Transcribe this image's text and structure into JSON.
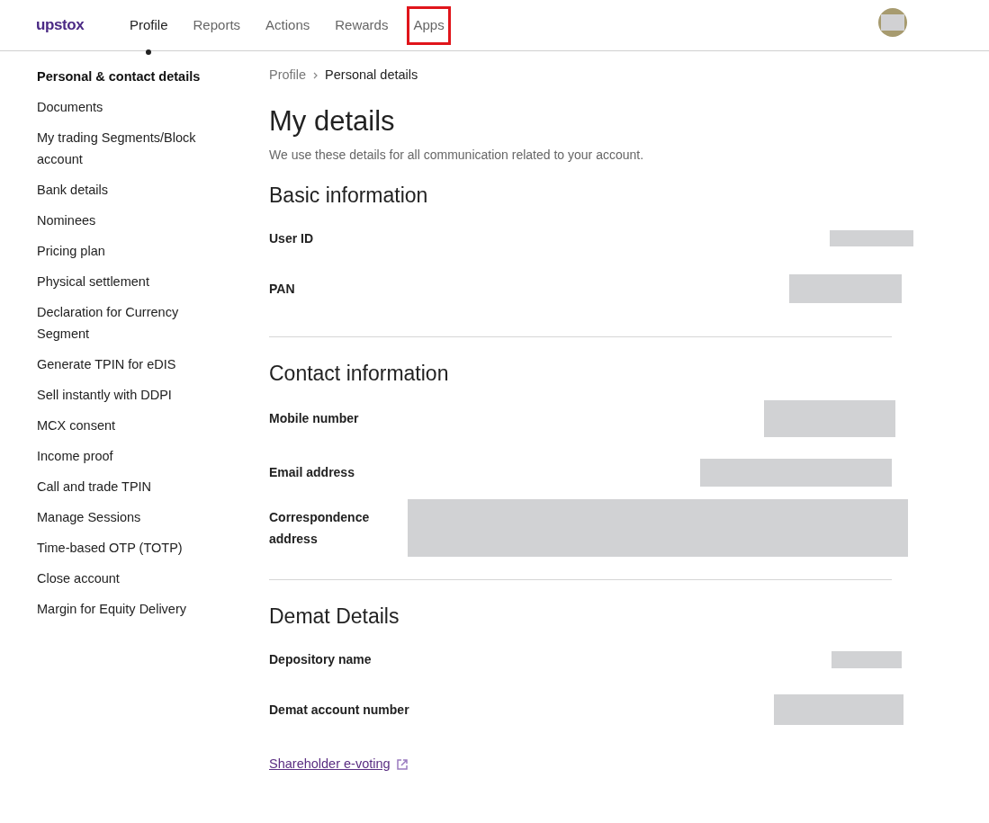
{
  "header": {
    "logo": "upstox",
    "tabs": [
      {
        "label": "Profile",
        "selected": true,
        "highlighted": false
      },
      {
        "label": "Reports",
        "selected": false,
        "highlighted": false
      },
      {
        "label": "Actions",
        "selected": false,
        "highlighted": false
      },
      {
        "label": "Rewards",
        "selected": false,
        "highlighted": false
      },
      {
        "label": "Apps",
        "selected": false,
        "highlighted": true
      }
    ]
  },
  "sidebar": {
    "items": [
      {
        "label": "Personal & contact details",
        "selected": true
      },
      {
        "label": "Documents",
        "selected": false
      },
      {
        "label": "My trading Segments/Block account",
        "selected": false
      },
      {
        "label": "Bank details",
        "selected": false
      },
      {
        "label": "Nominees",
        "selected": false
      },
      {
        "label": "Pricing plan",
        "selected": false
      },
      {
        "label": "Physical settlement",
        "selected": false
      },
      {
        "label": "Declaration for Currency Segment",
        "selected": false
      },
      {
        "label": "Generate TPIN for eDIS",
        "selected": false
      },
      {
        "label": "Sell instantly with DDPI",
        "selected": false
      },
      {
        "label": "MCX consent",
        "selected": false
      },
      {
        "label": "Income proof",
        "selected": false
      },
      {
        "label": "Call and trade TPIN",
        "selected": false
      },
      {
        "label": "Manage Sessions",
        "selected": false
      },
      {
        "label": "Time-based OTP (TOTP)",
        "selected": false
      },
      {
        "label": "Close account",
        "selected": false
      },
      {
        "label": "Margin for Equity Delivery",
        "selected": false
      }
    ]
  },
  "breadcrumb": [
    "Profile",
    "Personal details"
  ],
  "title": "My details",
  "subtitle": "We use these details for all communication related to your account.",
  "sections": [
    {
      "heading": "Basic information",
      "fields": [
        {
          "label": "User ID"
        },
        {
          "label": "PAN"
        }
      ]
    },
    {
      "heading": "Contact information",
      "fields": [
        {
          "label": "Mobile number"
        },
        {
          "label": "Email address"
        },
        {
          "label": "Correspondence address"
        }
      ]
    },
    {
      "heading": "Demat Details",
      "fields": [
        {
          "label": "Depository name"
        },
        {
          "label": "Demat account number"
        }
      ]
    }
  ],
  "link": "Shareholder e-voting"
}
